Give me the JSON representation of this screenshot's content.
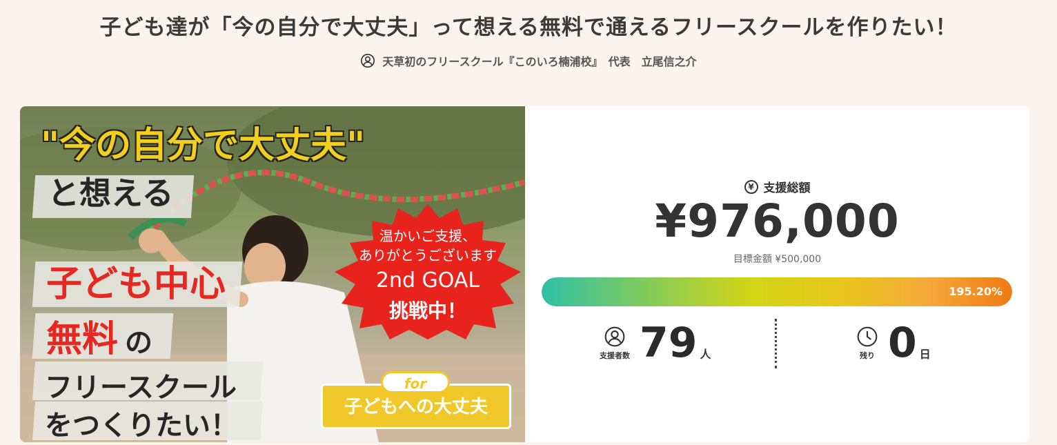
{
  "header": {
    "title": "子ども達が「今の自分で大丈夫」って想える無料で通えるフリースクールを作りたい！",
    "owner_icon": "user-circle-icon",
    "owner": "天草初のフリースクール『このいろ楠浦校』　代表　立尾信之介"
  },
  "hero": {
    "line1": "\"今の自分で大丈夫\"",
    "line2": "と想える",
    "line3": "子ども中心",
    "line4": "無料",
    "line4b": "の",
    "line5": "フリースクール",
    "line6": "をつくりたい！",
    "badge_line1": "温かいご支援、",
    "badge_line2": "ありがとうございます",
    "badge_line3": "2nd GOAL",
    "badge_line4": "挑戦中！",
    "for_label": "for",
    "tagline": "子どもへの大丈夫"
  },
  "funding": {
    "total_icon": "yen-circle-icon",
    "total_label": "支援総額",
    "amount": "¥976,000",
    "goal": "目標金額 ¥500,000",
    "progress_percent": 195.2,
    "progress_label": "195.20%",
    "supporters_icon": "user-circle-icon",
    "supporters_label": "支援者数",
    "supporters": "79",
    "supporters_unit": "人",
    "remaining_icon": "clock-icon",
    "remaining_label": "残り",
    "remaining": "0",
    "remaining_unit": "日"
  },
  "colors": {
    "page_bg": "#fbf3ee",
    "accent_red": "#e62822",
    "accent_yellow": "#f1c82a",
    "progress_start": "#2fc0a6",
    "progress_end": "#ee7a14"
  }
}
